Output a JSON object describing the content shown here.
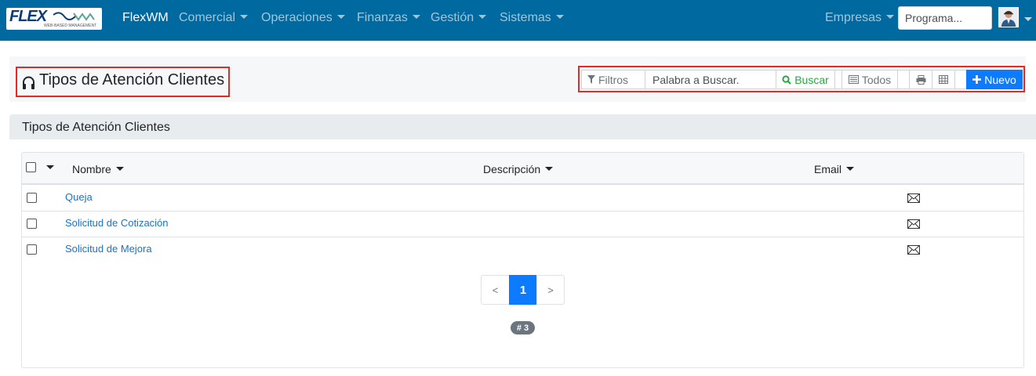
{
  "navbar": {
    "logo_text": "FLEX",
    "logo_wm": "WM",
    "logo_sub": "WEB-BASED MANAGEMENT",
    "brand": "FlexWM",
    "menus": [
      "Comercial",
      "Operaciones",
      "Finanzas",
      "Gestión",
      "Sistemas"
    ],
    "right_menu": "Empresas",
    "program_search_placeholder": "Programa...",
    "avatar_icon": "user-avatar-icon",
    "bg_color": "#0069a0"
  },
  "page": {
    "title": "Tipos de Atención Clientes",
    "title_icon": "headphones-icon"
  },
  "toolbar": {
    "filters_label": "Filtros",
    "search_placeholder": "Palabra a Buscar.",
    "search_label": "Buscar",
    "all_label": "Todos",
    "new_label": "Nuevo",
    "accent_color": "#0d7bff"
  },
  "section": {
    "title": "Tipos de Atención Clientes"
  },
  "table": {
    "columns": [
      "Nombre",
      "Descripción",
      "Email"
    ],
    "rows": [
      {
        "name": "Queja",
        "description": "",
        "email_icon": "envelope-icon"
      },
      {
        "name": "Solicitud de Cotización",
        "description": "",
        "email_icon": "envelope-icon"
      },
      {
        "name": "Solicitud de Mejora",
        "description": "",
        "email_icon": "envelope-icon"
      }
    ]
  },
  "pagination": {
    "prev": "<",
    "current": "1",
    "next": ">",
    "count_badge": "# 3"
  }
}
